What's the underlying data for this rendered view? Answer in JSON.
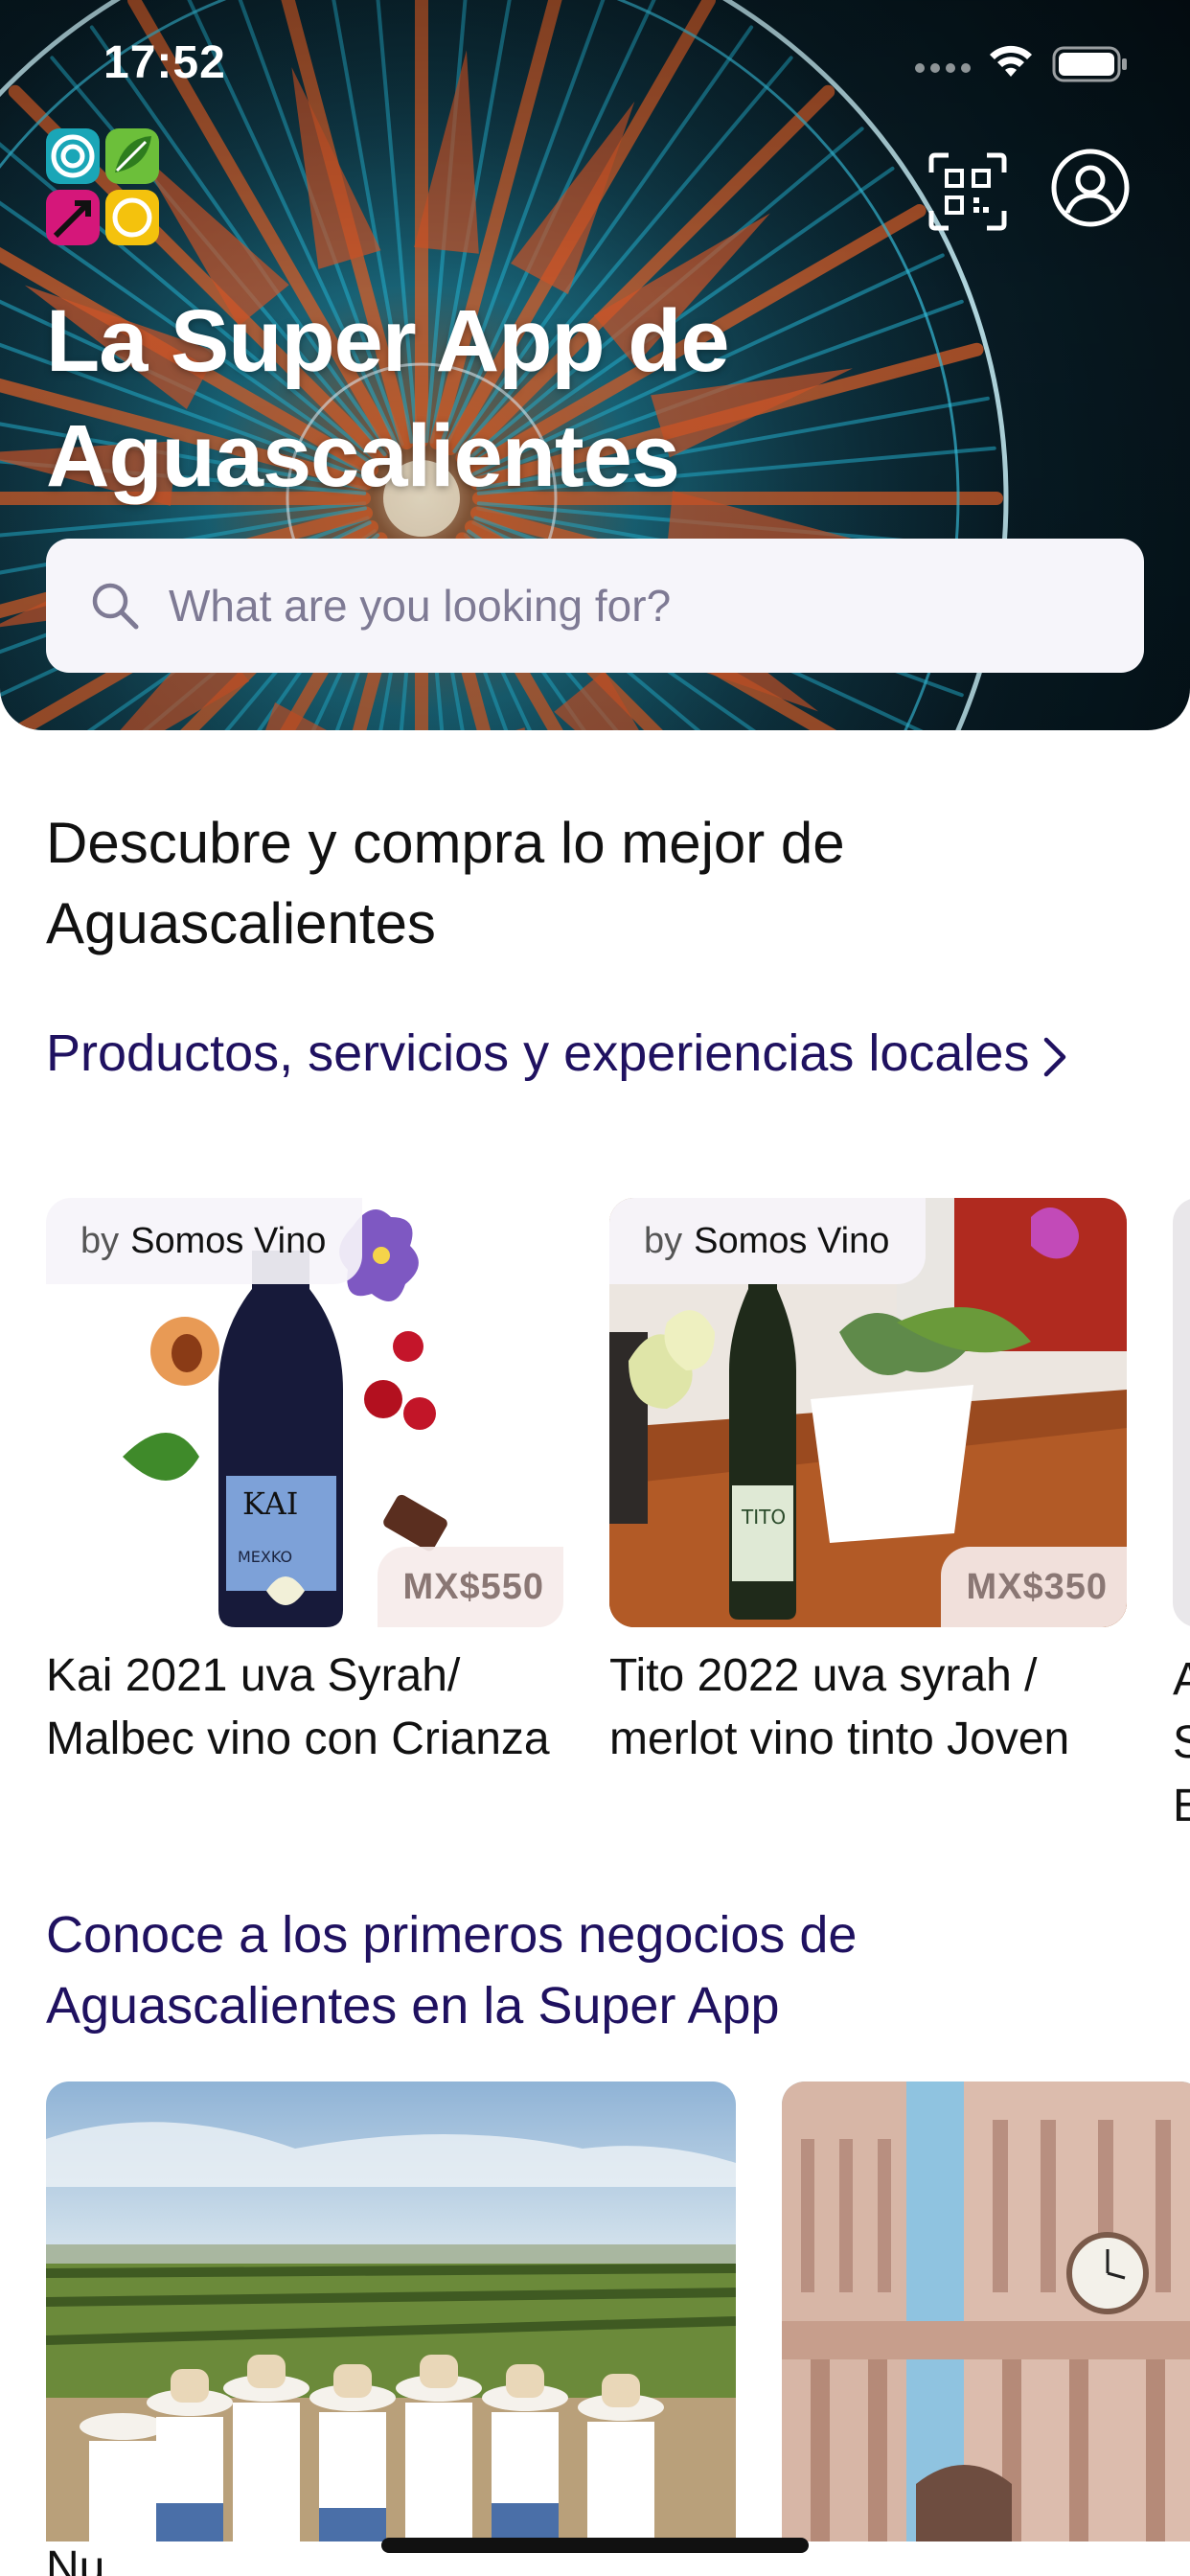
{
  "status_bar": {
    "time": "17:52"
  },
  "header": {
    "title": "La Super App de Aguascalientes",
    "icons": [
      "app-logo",
      "qr-scan-icon",
      "profile-icon"
    ]
  },
  "search": {
    "placeholder": "What are you looking for?"
  },
  "intro": {
    "heading": "Descubre y compra lo mejor de Aguascalientes"
  },
  "products_section": {
    "title": "Productos, servicios y experiencias locales",
    "items": [
      {
        "vendor_prefix": "by",
        "vendor": "Somos Vino",
        "price": "MX$550",
        "name": "Kai 2021 uva Syrah/ Malbec  vino con Crianza"
      },
      {
        "vendor_prefix": "by",
        "vendor": "Somos Vino",
        "price": "MX$350",
        "name": "Tito 2022  uva syrah / merlot   vino tinto Joven"
      }
    ],
    "peek_text": "A\nS\nE"
  },
  "business_section": {
    "title": "Conoce a los primeros negocios de Aguascalientes en la Super App",
    "items": [
      {
        "name": "Nu"
      },
      {
        "name": ""
      }
    ]
  },
  "colors": {
    "link": "#1f1160",
    "search_bg": "#f6f5fa",
    "price_text": "#8a7774",
    "logo_green": "#6cbf3a",
    "logo_magenta": "#d5177a",
    "logo_yellow": "#f4c20d",
    "logo_teal": "#1aa6b7"
  }
}
